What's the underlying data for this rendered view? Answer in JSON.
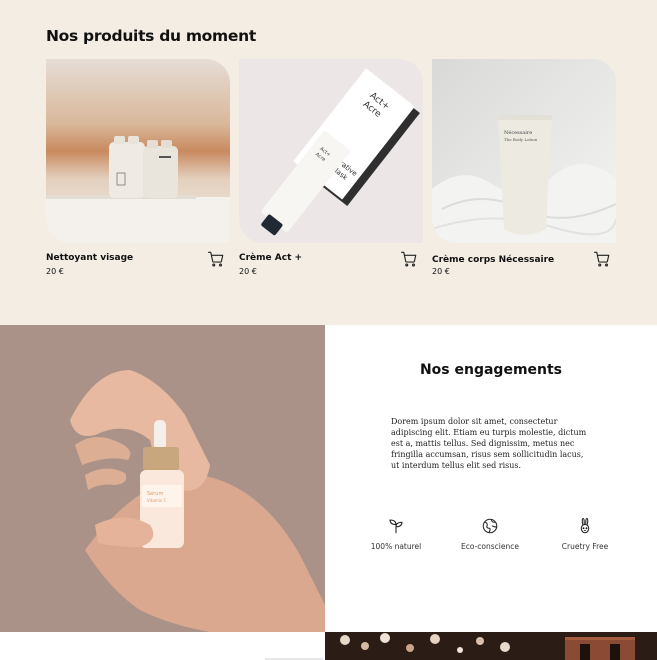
{
  "products": {
    "title": "Nos produits du moment",
    "items": [
      {
        "name": "Nettoyant visage",
        "price": "20 €"
      },
      {
        "name": "Crème Act +",
        "price": "20 €"
      },
      {
        "name": "Crème corps Nécessaire",
        "price": "20 €"
      }
    ]
  },
  "engagements": {
    "title": "Nos engagements",
    "text": "Dorem ipsum dolor sit amet, consectetur adipiscing elit. Etiam eu turpis molestie, dictum est a, mattis tellus. Sed dignissim, metus nec fringilla accumsan, risus sem sollicitudin lacus, ut interdum tellus elit sed risus.",
    "features": [
      {
        "label": "100% naturel",
        "icon": "sprout-icon"
      },
      {
        "label": "Eco-conscience",
        "icon": "globe-icon"
      },
      {
        "label": "Cruetry Free",
        "icon": "rabbit-icon"
      }
    ]
  },
  "colors": {
    "section_bg": "#f3ede3",
    "hand_bg": "#ab9289"
  }
}
